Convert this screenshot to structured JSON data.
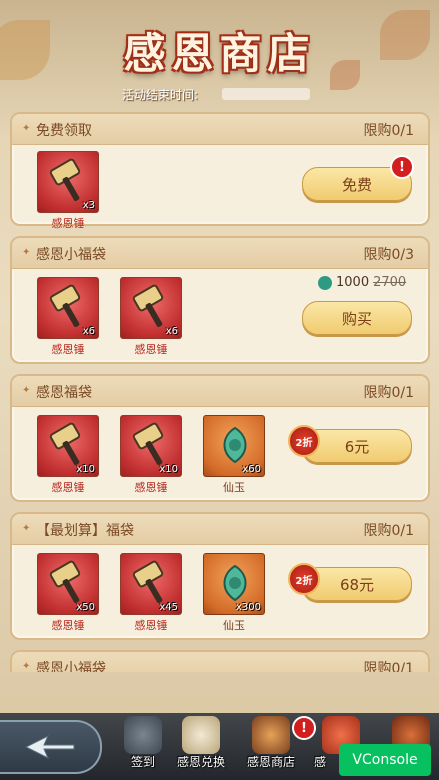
{
  "header": {
    "title": "感恩商店",
    "subtitle": "活动结束时间:"
  },
  "cards": [
    {
      "title": "免费领取",
      "limit": "限购0/1",
      "items": [
        {
          "name": "感恩锤",
          "qty": "x3"
        }
      ],
      "button": "免费",
      "badge": "!"
    },
    {
      "title": "感恩小福袋",
      "limit": "限购0/3",
      "items": [
        {
          "name": "感恩锤",
          "qty": "x6"
        },
        {
          "name": "感恩锤",
          "qty": "x6"
        }
      ],
      "price_current": "1000",
      "price_original": "2700",
      "button": "购买"
    },
    {
      "title": "感恩福袋",
      "limit": "限购0/1",
      "items": [
        {
          "name": "感恩锤",
          "qty": "x10"
        },
        {
          "name": "感恩锤",
          "qty": "x10"
        },
        {
          "name": "仙玉",
          "qty": "x60"
        }
      ],
      "discount": "2折",
      "button": "6元"
    },
    {
      "title": "【最划算】福袋",
      "limit": "限购0/1",
      "items": [
        {
          "name": "感恩锤",
          "qty": "x50"
        },
        {
          "name": "感恩锤",
          "qty": "x45"
        },
        {
          "name": "仙玉",
          "qty": "x300"
        }
      ],
      "discount": "2折",
      "button": "68元"
    },
    {
      "title": "感恩小福袋",
      "limit": "限购0/1"
    }
  ],
  "nav": {
    "items": [
      {
        "label": "签到"
      },
      {
        "label": "感恩兑换"
      },
      {
        "label": "感恩商店",
        "badge": "!"
      },
      {
        "label": "感"
      }
    ]
  },
  "vconsole": "VConsole",
  "colors": {
    "accent": "#b8281e",
    "button": "#f0cb70",
    "badge": "#d21e1e",
    "vconsole": "#07c160"
  }
}
